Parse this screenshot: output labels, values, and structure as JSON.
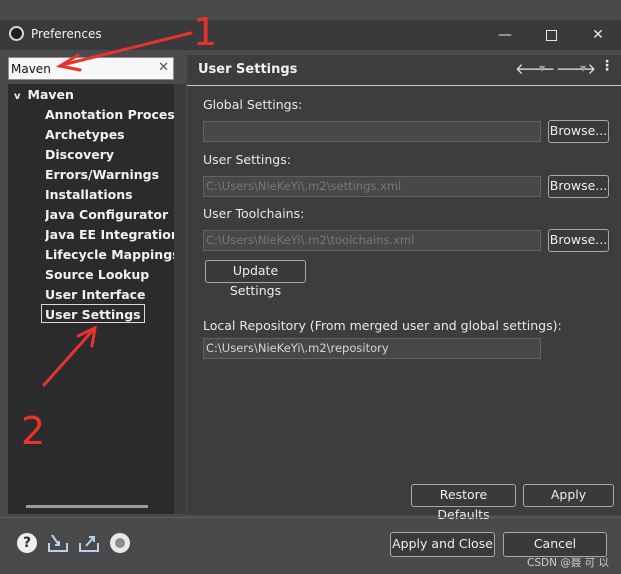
{
  "window": {
    "title": "Preferences",
    "minimize": "—",
    "close": "✕"
  },
  "filter": {
    "value": "Maven",
    "clear": "✕"
  },
  "tree": {
    "root": {
      "arrow": "v",
      "label": "Maven"
    },
    "items": [
      "Annotation Processing",
      "Archetypes",
      "Discovery",
      "Errors/Warnings",
      "Installations",
      "Java Configurator",
      "Java EE Integration",
      "Lifecycle Mappings",
      "Source Lookup",
      "User Interface"
    ],
    "selected": "User Settings"
  },
  "page": {
    "title": "User Settings",
    "nav": {
      "back": "🡐",
      "forward": "🡒",
      "dropdown": "▼",
      "menu": "⋮"
    },
    "global_label": "Global Settings:",
    "global_value": "",
    "user_label": "User Settings:",
    "user_value": "C:\\Users\\NieKeYi\\.m2\\settings.xml",
    "toolchains_label": "User Toolchains:",
    "toolchains_value": "C:\\Users\\NieKeYi\\.m2\\toolchains.xml",
    "browse": "Browse...",
    "update_button": "Update Settings",
    "local_repo_label": "Local Repository (From merged user and global settings):",
    "local_repo_value": "C:\\Users\\NieKeYi\\.m2\\repository",
    "restore_defaults": "Restore Defaults",
    "apply": "Apply"
  },
  "footer": {
    "help": "?",
    "apply_and_close": "Apply and Close",
    "cancel": "Cancel"
  },
  "annotations": {
    "one": "1",
    "two": "2"
  },
  "watermark": "CSDN @聂 可 以",
  "colors": {
    "annotation": "#e8322a",
    "background": "#4a4a4d",
    "tree_bg": "#2b2b2d"
  },
  "icons": [
    "app-icon",
    "help-icon",
    "import-icon",
    "export-icon",
    "oomph-icon"
  ]
}
